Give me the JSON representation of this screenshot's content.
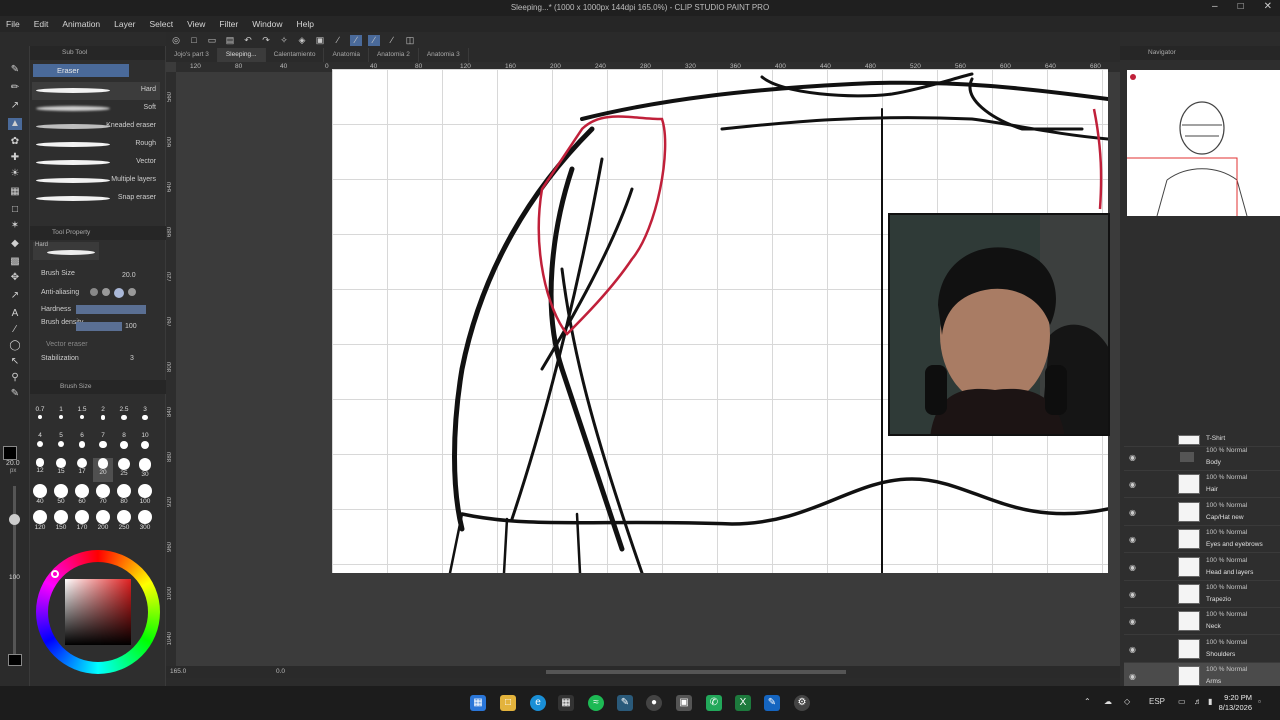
{
  "window": {
    "title": "Sleeping...* (1000 x 1000px 144dpi 165.0%) - CLIP STUDIO PAINT PRO"
  },
  "menu": [
    "File",
    "Edit",
    "Animation",
    "Layer",
    "Select",
    "View",
    "Filter",
    "Window",
    "Help"
  ],
  "subtool": {
    "panel_title": "Sub Tool",
    "group": "Eraser",
    "brushes": [
      "Hard",
      "Soft",
      "Kneaded eraser",
      "Rough",
      "Vector",
      "Multiple layers",
      "Snap eraser"
    ]
  },
  "tool_property": {
    "title": "Tool Property",
    "preset": "Hard",
    "brush_size_label": "Brush Size",
    "brush_size_value": "20.0",
    "anti_aliasing_label": "Anti-aliasing",
    "hardness_label": "Hardness",
    "brush_density_label": "Brush density",
    "brush_density_value": "100",
    "vector_eraser_label": "Vector eraser",
    "stabilization_label": "Stabilization",
    "stabilization_value": "3"
  },
  "brush_size_panel": {
    "title": "Brush Size",
    "sizes": [
      "0.7",
      "1",
      "1.5",
      "2",
      "2.5",
      "3",
      "4",
      "5",
      "6",
      "7",
      "8",
      "10",
      "12",
      "15",
      "17",
      "20",
      "25",
      "30",
      "40",
      "50",
      "60",
      "70",
      "80",
      "100",
      "120",
      "150",
      "170",
      "200",
      "250",
      "300"
    ],
    "selected": "20"
  },
  "toolstrip": {
    "size_value": "20.0",
    "size_unit": "px",
    "opacity_value": "100"
  },
  "document_tabs": [
    "Jojo's part 3",
    "Sleeping...",
    "Calentamiento",
    "Anatomia",
    "Anatomia 2",
    "Anatomia 3"
  ],
  "ruler": {
    "horizontal": [
      "120",
      "80",
      "40",
      "0",
      "40",
      "80",
      "120",
      "160",
      "200",
      "240",
      "280",
      "320",
      "360",
      "400",
      "440",
      "480",
      "520",
      "560",
      "600",
      "640",
      "680"
    ],
    "vertical": [
      "560",
      "600",
      "640",
      "680",
      "720",
      "760",
      "800",
      "840",
      "880",
      "920",
      "960",
      "1000",
      "1040"
    ]
  },
  "statusbar": {
    "zoom": "165.0",
    "rotation": "0.0"
  },
  "navigator": {
    "title": "Navigator"
  },
  "layers": [
    {
      "mode": "",
      "name": "T-Shirt"
    },
    {
      "mode": "100 % Normal",
      "name": "Body"
    },
    {
      "mode": "100 % Normal",
      "name": "Hair"
    },
    {
      "mode": "100 % Normal",
      "name": "Cap/Hat new"
    },
    {
      "mode": "100 % Normal",
      "name": "Eyes and eyebrows"
    },
    {
      "mode": "100 % Normal",
      "name": "Head and layers"
    },
    {
      "mode": "100 % Normal",
      "name": "Trapezio"
    },
    {
      "mode": "100 % Normal",
      "name": "Neck"
    },
    {
      "mode": "100 % Normal",
      "name": "Shoulders"
    },
    {
      "mode": "100 % Normal",
      "name": "Arms"
    }
  ],
  "taskbar": {
    "language": "ESP",
    "time": "9:20 PM",
    "date": "8/13/2026"
  },
  "colors": {
    "accent": "#4a6a9a",
    "sketch_red": "#c0203a"
  }
}
